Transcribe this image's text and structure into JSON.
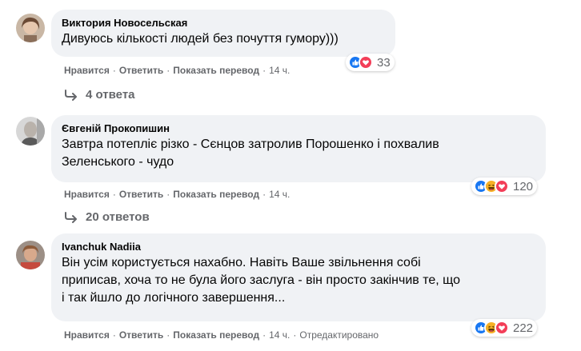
{
  "comments": [
    {
      "author": "Виктория Новосельская",
      "text_lines": [
        "Дивуюсь кількості людей без почуття гумору)))"
      ],
      "reactions": [
        "like",
        "love"
      ],
      "reaction_count": "33",
      "actions": {
        "like": "Нравится",
        "reply": "Ответить",
        "translate": "Показать перевод",
        "time": "14 ч."
      },
      "replies": "4 ответа"
    },
    {
      "author": "Євгеній Прокопишин",
      "text_lines": [
        "Завтра потепліє різко - Сєнцов затролив Порошенко і похвалив",
        "Зеленського - чудо"
      ],
      "reactions": [
        "like",
        "haha",
        "love"
      ],
      "reaction_count": "120",
      "actions": {
        "like": "Нравится",
        "reply": "Ответить",
        "translate": "Показать перевод",
        "time": "14 ч."
      },
      "replies": "20 ответов"
    },
    {
      "author": "Ivanchuk Nadiia",
      "text_lines": [
        "Він усім користується нахабно. Навіть Ваше звільнення собі",
        "приписав, хоча то не була його заслуга - він просто закінчив те, що",
        "і так йшло до логічного завершення..."
      ],
      "reactions": [
        "like",
        "haha",
        "love"
      ],
      "reaction_count": "222",
      "actions": {
        "like": "Нравится",
        "reply": "Ответить",
        "translate": "Показать перевод",
        "time": "14 ч.",
        "edited": "Отредактировано"
      }
    }
  ],
  "colors": {
    "bubble": "#f0f2f5",
    "meta": "#65676b",
    "like": "#1877f2",
    "love": "#f33e58",
    "haha": "#f7b125"
  }
}
